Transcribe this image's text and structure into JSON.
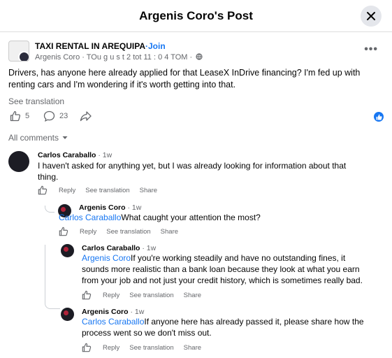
{
  "header": {
    "title": "Argenis Coro's Post"
  },
  "post": {
    "group_name": "TAXI RENTAL IN AREQUIPA",
    "join_label": "·Join",
    "meta": "Argenis Coro · TOu g u s t  2 tot  11 : 0 4  TOM  ·",
    "text": "Drivers, has anyone here already applied for that LeaseX InDrive financing? I'm fed up with renting cars and I'm wondering if it's worth getting into that.",
    "see_translation": "See translation",
    "like_count": "5",
    "comment_count": "23"
  },
  "comments_filter": "All comments",
  "actions": {
    "reply": "Reply",
    "see_translation": "See translation",
    "share": "Share"
  },
  "comments": [
    {
      "author": "Carlos Caraballo",
      "time": "· 1w",
      "text": "I haven't asked for anything yet, but I was already looking for information about that thing."
    },
    {
      "author": "Argenis Coro",
      "time": "· 1w",
      "mention": "Carlos Caraballo",
      "text": "What caught your attention the most?"
    },
    {
      "author": "Carlos Caraballo",
      "time": "· 1w",
      "mention": "Argenis Coro",
      "text": "If you're working steadily and have no outstanding fines, it sounds more realistic than a bank loan because they look at what you earn from your job and not just your credit history, which is sometimes really bad."
    },
    {
      "author": "Argenis Coro",
      "time": "· 1w",
      "mention": "Carlos Caraballo",
      "text": "If anyone here has already passed it, please share how the process went so we don't miss out."
    }
  ],
  "colors": {
    "accent": "#1877f2",
    "muted": "#65676b"
  }
}
